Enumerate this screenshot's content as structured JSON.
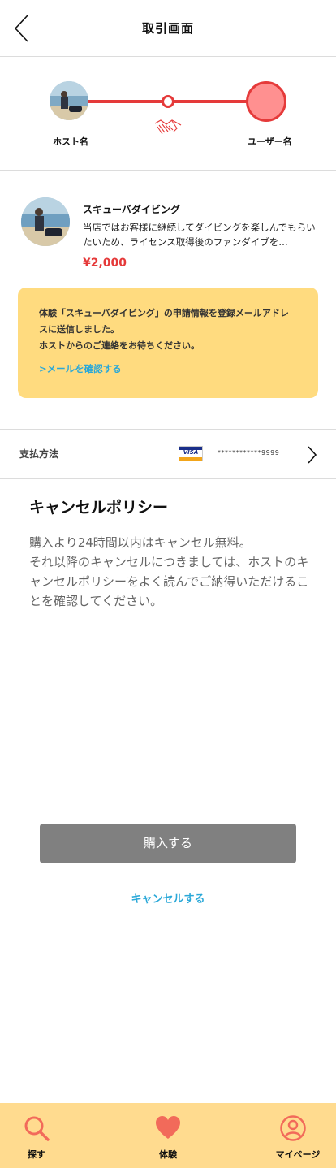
{
  "header": {
    "title": "取引画面"
  },
  "progress": {
    "host_label": "ホスト名",
    "user_label": "ユーザー名"
  },
  "product": {
    "name": "スキューバダイビング",
    "description": "当店ではお客様に継続してダイビングを楽しんでもらいたいため、ライセンス取得後のファンダイブを…",
    "price": "¥2,000"
  },
  "notice": {
    "message": "体験「スキューバダイビング」の申請情報を登録メールアドレスに送信しました。\nホストからのご連絡をお待ちください。",
    "link_label": ">メールを確認する"
  },
  "payment": {
    "label": "支払方法",
    "card_brand": "VISA",
    "card_number": "************9999"
  },
  "policy": {
    "title": "キャンセルポリシー",
    "text": "購入より24時間以内はキャンセル無料。\nそれ以降のキャンセルにつきましては、ホストのキャンセルポリシーをよく読んでご納得いただけることを確認してください。"
  },
  "actions": {
    "buy_label": "購入する",
    "cancel_label": "キャンセルする"
  },
  "bottom_nav": {
    "items": [
      {
        "label": "探す",
        "icon": "search-icon"
      },
      {
        "label": "体験",
        "icon": "heart-icon"
      },
      {
        "label": "マイページ",
        "icon": "user-icon"
      }
    ]
  },
  "colors": {
    "accent_red": "#e53a3a",
    "user_circle": "#ff9090",
    "notice_bg": "#ffdb7f",
    "link_blue": "#2aa8d8",
    "nav_bg": "#ffdb8f",
    "nav_icon": "#f26a5a",
    "button_gray": "#808080"
  }
}
